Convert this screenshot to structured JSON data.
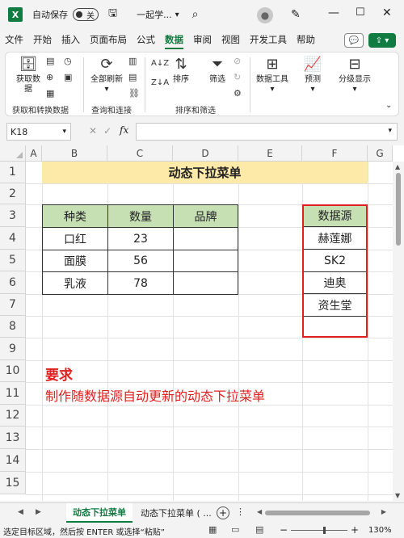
{
  "titlebar": {
    "app_logo": "X",
    "autosave_label": "自动保存",
    "autosave_state": "关",
    "document_title": "一起学...",
    "icons": [
      "excel-logo-icon",
      "save-icon",
      "search-icon",
      "avatar-icon",
      "pen-icon",
      "minimize-icon",
      "maximize-icon",
      "close-icon"
    ]
  },
  "menu": {
    "tabs": [
      "文件",
      "开始",
      "插入",
      "页面布局",
      "公式",
      "数据",
      "审阅",
      "视图",
      "开发工具",
      "帮助"
    ],
    "active_tab": "数据"
  },
  "ribbon": {
    "get_data_line1": "获取数",
    "get_data_line2": "据",
    "refresh_all_line1": "全部刷新",
    "sort_label": "排序",
    "filter_label": "筛选",
    "data_tools_label": "数据工具",
    "forecast_label": "预测",
    "outline_label": "分级显示",
    "group_get_transform": "获取和转换数据",
    "group_queries": "查询和连接",
    "group_sort_filter": "排序和筛选"
  },
  "formula_bar": {
    "name_box": "K18",
    "fx_label": "fx",
    "formula": ""
  },
  "grid": {
    "columns": [
      "A",
      "B",
      "C",
      "D",
      "E",
      "F",
      "G"
    ],
    "rows": [
      "1",
      "2",
      "3",
      "4",
      "5",
      "6",
      "7",
      "8",
      "9",
      "10",
      "11",
      "12",
      "13",
      "14",
      "15"
    ],
    "title": "动态下拉菜单",
    "table_headers": [
      "种类",
      "数量",
      "品牌"
    ],
    "table_rows": [
      [
        "口红",
        "23",
        ""
      ],
      [
        "面膜",
        "56",
        ""
      ],
      [
        "乳液",
        "78",
        ""
      ]
    ],
    "datasource_header": "数据源",
    "datasource_items": [
      "赫莲娜",
      "SK2",
      "迪奥",
      "资生堂",
      ""
    ],
    "requirement_title": "要求",
    "requirement_text": "制作随数据源自动更新的动态下拉菜单"
  },
  "sheets": {
    "tabs": [
      "动态下拉菜单",
      "动态下拉菜单 ( ..."
    ],
    "active": "动态下拉菜单"
  },
  "status": {
    "text": "选定目标区域，然后按 ENTER 或选择“粘贴”",
    "zoom": "130%"
  },
  "colors": {
    "accent": "#107c41",
    "title_fill": "#fde9a8",
    "header_fill": "#c6e0b4",
    "highlight_border": "#e01f1f",
    "requirement_text": "#e01f1f"
  }
}
